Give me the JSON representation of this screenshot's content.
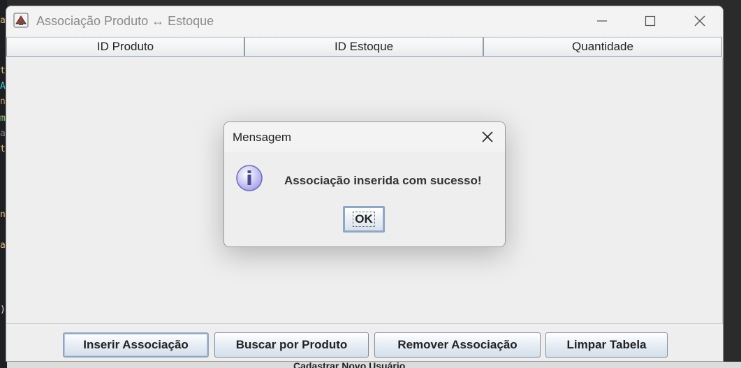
{
  "window": {
    "title": "Associação Produto ↔ Estoque",
    "controls": {
      "minimize": "minimize-icon",
      "maximize": "maximize-icon",
      "close": "close-icon"
    }
  },
  "table": {
    "columns": [
      "ID Produto",
      "ID Estoque",
      "Quantidade"
    ],
    "rows": []
  },
  "buttons": {
    "insert": "Inserir Associação",
    "search": "Buscar por Produto",
    "remove": "Remover Associação",
    "clear": "Limpar Tabela"
  },
  "dialog": {
    "title": "Mensagem",
    "message": "Associação inserida com sucesso!",
    "ok_label": "OK",
    "icon": "info-icon"
  },
  "background": {
    "partial_label": "Cadastrar Novo Usuário"
  },
  "colors": {
    "header_border": "#8f9aa6",
    "button_border": "#7e8c9c",
    "focus_border": "#8ea7c4",
    "info_icon": "#8a86d6"
  }
}
